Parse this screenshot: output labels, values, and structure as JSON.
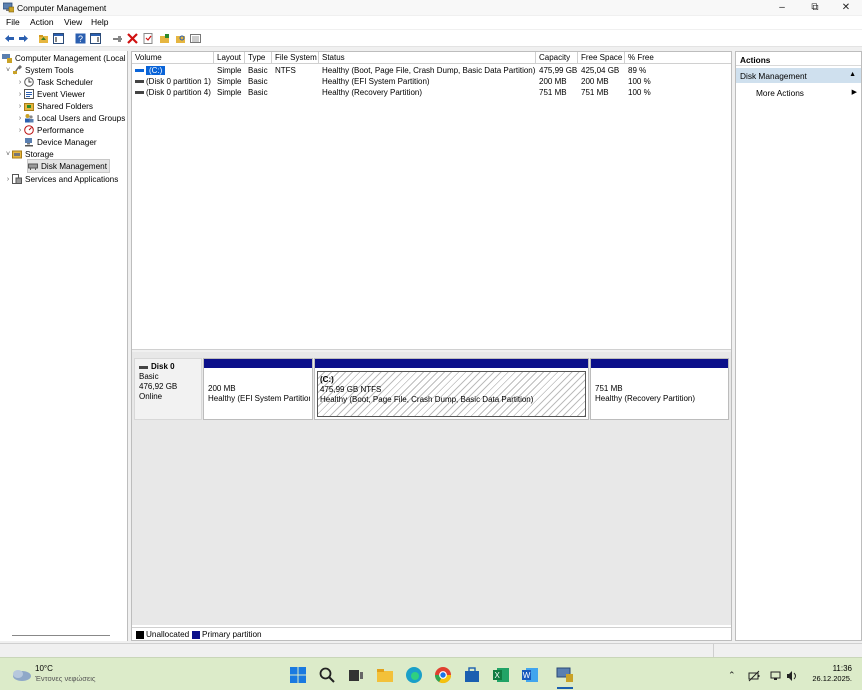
{
  "window": {
    "title": "Computer Management",
    "minimize": "–",
    "maximize": "⧉",
    "close": "✕"
  },
  "menu": [
    "File",
    "Action",
    "View",
    "Help"
  ],
  "tree": {
    "root": "Computer Management (Local",
    "items": [
      {
        "label": "System Tools",
        "level": 1,
        "chevron": "˅"
      },
      {
        "label": "Task Scheduler",
        "level": 2,
        "chevron": "›"
      },
      {
        "label": "Event Viewer",
        "level": 2,
        "chevron": "›"
      },
      {
        "label": "Shared Folders",
        "level": 2,
        "chevron": "›"
      },
      {
        "label": "Local Users and Groups",
        "level": 2,
        "chevron": "›"
      },
      {
        "label": "Performance",
        "level": 2,
        "chevron": "›"
      },
      {
        "label": "Device Manager",
        "level": 2,
        "chevron": ""
      },
      {
        "label": "Storage",
        "level": 1,
        "chevron": "˅"
      },
      {
        "label": "Disk Management",
        "level": 2,
        "chevron": ""
      },
      {
        "label": "Services and Applications",
        "level": 1,
        "chevron": "›"
      }
    ]
  },
  "volume_table": {
    "columns": [
      "Volume",
      "Layout",
      "Type",
      "File System",
      "Status",
      "Capacity",
      "Free Space",
      "% Free"
    ],
    "rows": [
      [
        "(C:)",
        "Simple",
        "Basic",
        "NTFS",
        "Healthy (Boot, Page File, Crash Dump, Basic Data Partition)",
        "475,99 GB",
        "425,04 GB",
        "89 %"
      ],
      [
        "(Disk 0 partition 1)",
        "Simple",
        "Basic",
        "",
        "Healthy (EFI System Partition)",
        "200 MB",
        "200 MB",
        "100 %"
      ],
      [
        "(Disk 0 partition 4)",
        "Simple",
        "Basic",
        "",
        "Healthy (Recovery Partition)",
        "751 MB",
        "751 MB",
        "100 %"
      ]
    ]
  },
  "disk": {
    "name": "Disk 0",
    "type": "Basic",
    "size": "476,92 GB",
    "state": "Online",
    "partitions": [
      {
        "title": "",
        "line1": "200 MB",
        "line2": "Healthy (EFI System Partition)"
      },
      {
        "title": "(C:)",
        "line1": "475,99 GB NTFS",
        "line2": "Healthy (Boot, Page File, Crash Dump, Basic Data Partition)"
      },
      {
        "title": "",
        "line1": "751 MB",
        "line2": "Healthy (Recovery Partition)"
      }
    ]
  },
  "legend": {
    "unallocated": "Unallocated",
    "primary": "Primary partition"
  },
  "actions": {
    "header": "Actions",
    "section": "Disk Management",
    "more": "More Actions"
  },
  "taskbar": {
    "weather_temp": "10°C",
    "weather_desc": "Έντονες νεφώσεις",
    "time": "11:36",
    "date": "26.12.2025."
  },
  "colors": {
    "primary_partition": "#0b0f8a",
    "selection": "#0a64d8",
    "actions_section": "#cfe0ee",
    "taskbar": "#dcebc9"
  }
}
